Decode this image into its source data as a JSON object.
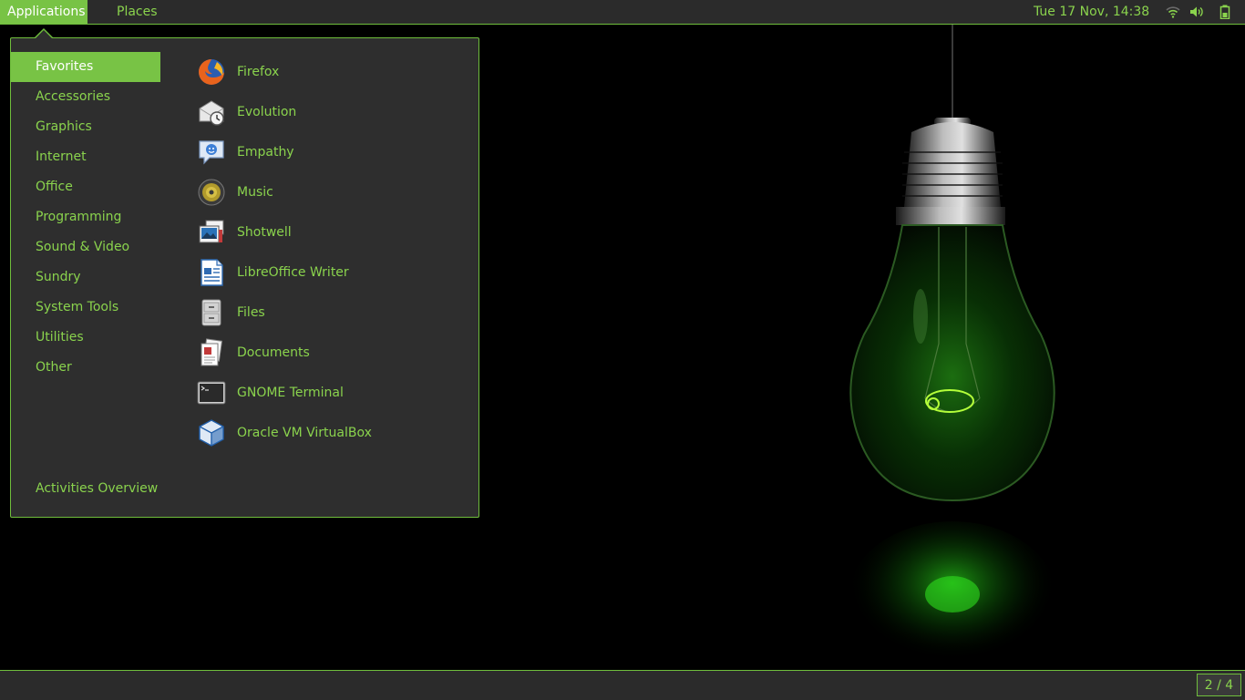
{
  "top_panel": {
    "applications_label": "Applications",
    "places_label": "Places",
    "clock": "Tue 17 Nov, 14:38",
    "tray_icons": [
      "wifi-icon",
      "volume-icon",
      "battery-icon"
    ]
  },
  "menu": {
    "categories": [
      {
        "label": "Favorites",
        "active": true
      },
      {
        "label": "Accessories"
      },
      {
        "label": "Graphics"
      },
      {
        "label": "Internet"
      },
      {
        "label": "Office"
      },
      {
        "label": "Programming"
      },
      {
        "label": "Sound & Video"
      },
      {
        "label": "Sundry"
      },
      {
        "label": "System Tools"
      },
      {
        "label": "Utilities"
      },
      {
        "label": "Other"
      }
    ],
    "apps": [
      {
        "label": "Firefox",
        "icon": "firefox-icon"
      },
      {
        "label": "Evolution",
        "icon": "evolution-icon"
      },
      {
        "label": "Empathy",
        "icon": "empathy-icon"
      },
      {
        "label": "Music",
        "icon": "music-icon"
      },
      {
        "label": "Shotwell",
        "icon": "shotwell-icon"
      },
      {
        "label": "LibreOffice Writer",
        "icon": "writer-icon"
      },
      {
        "label": "Files",
        "icon": "files-icon"
      },
      {
        "label": "Documents",
        "icon": "documents-icon"
      },
      {
        "label": "GNOME Terminal",
        "icon": "terminal-icon"
      },
      {
        "label": "Oracle VM VirtualBox",
        "icon": "virtualbox-icon"
      }
    ],
    "activities_label": "Activities Overview"
  },
  "bottom_panel": {
    "workspace_indicator": "2 / 4"
  },
  "colors": {
    "accent": "#78c345",
    "text_green": "#8ad34d",
    "panel_bg": "#2b2b2b",
    "menu_bg": "#2e2e2e",
    "desktop_bg": "#000000"
  }
}
